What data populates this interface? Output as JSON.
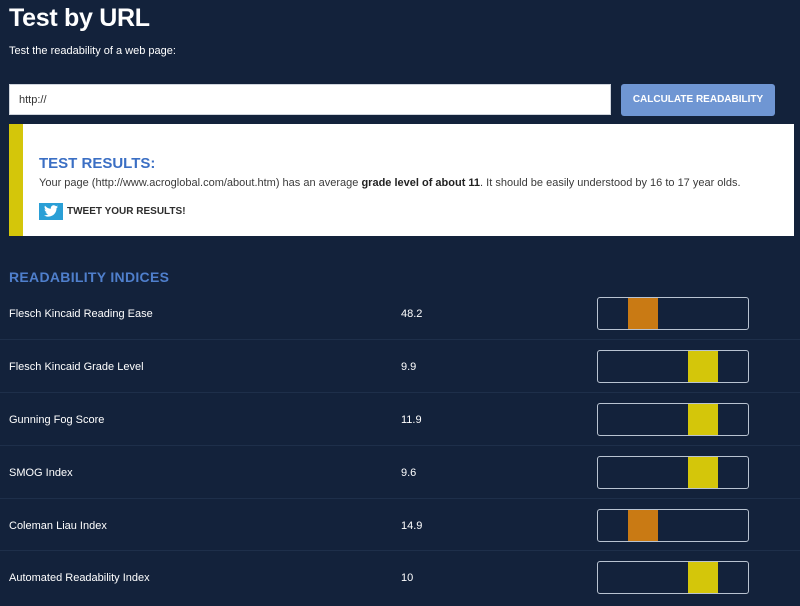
{
  "page": {
    "title": "Test by URL",
    "subtitle": "Test the readability of a web page:"
  },
  "form": {
    "url_value": "http://",
    "submit_label": "CALCULATE READABILITY"
  },
  "results": {
    "heading": "TEST RESULTS:",
    "text_before": "Your page (http://www.acroglobal.com/about.htm) has an average ",
    "text_bold": "grade level of about 11",
    "text_after": ". It should be easily understood by 16 to 17 year olds.",
    "tweet_label": "TWEET YOUR RESULTS!",
    "tweet_icon": "twitter-bird-icon"
  },
  "indices": {
    "heading": "READABILITY INDICES",
    "items": [
      {
        "label": "Flesch Kincaid Reading Ease",
        "value": "48.2",
        "marker_position": 0.2,
        "marker_color": "#c97a14"
      },
      {
        "label": "Flesch Kincaid Grade Level",
        "value": "9.9",
        "marker_position": 0.6,
        "marker_color": "#d4c60a"
      },
      {
        "label": "Gunning Fog Score",
        "value": "11.9",
        "marker_position": 0.6,
        "marker_color": "#d4c60a"
      },
      {
        "label": "SMOG Index",
        "value": "9.6",
        "marker_position": 0.6,
        "marker_color": "#d4c60a"
      },
      {
        "label": "Coleman Liau Index",
        "value": "14.9",
        "marker_position": 0.2,
        "marker_color": "#c97a14"
      },
      {
        "label": "Automated Readability Index",
        "value": "10",
        "marker_position": 0.6,
        "marker_color": "#d4c60a"
      }
    ]
  },
  "colors": {
    "background": "#13223b",
    "accent_blue": "#3b6fc4",
    "button": "#6f96d3",
    "highlight_yellow": "#d4c60a",
    "warning_orange": "#c97a14",
    "twitter": "#2a9fd6"
  }
}
